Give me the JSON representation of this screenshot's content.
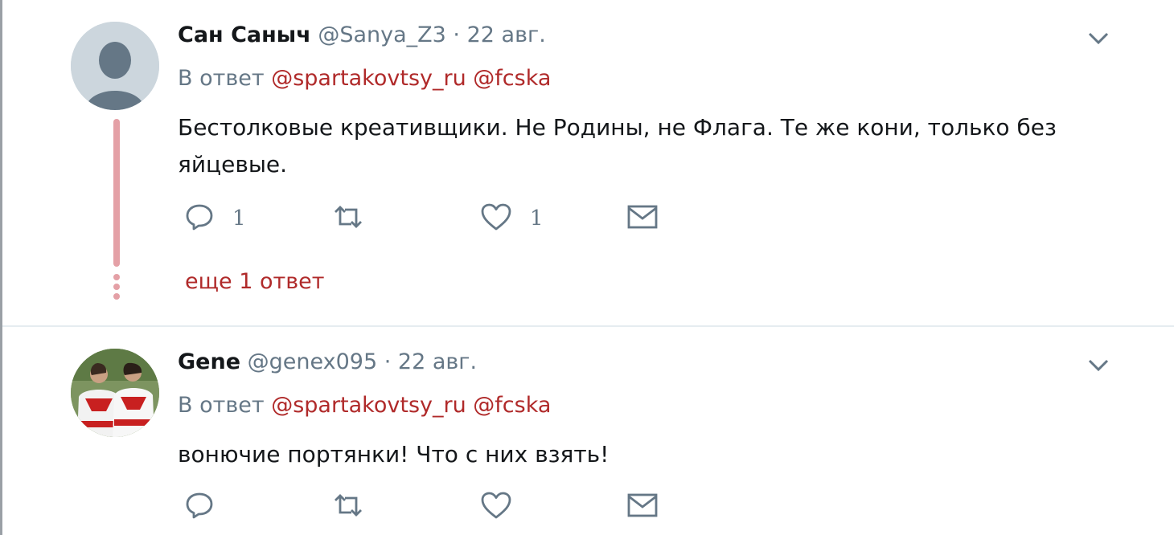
{
  "tweets": [
    {
      "name": "Сан Саныч",
      "handle": "@Sanya_Z3",
      "sep": "·",
      "date": "22 авг.",
      "reply_prefix": "В ответ",
      "mentions": [
        "@spartakovtsy_ru",
        "@fcska"
      ],
      "text": "Бестолковые креативщики. Не Родины, не Флага. Те же кони, только без яйцевые.",
      "reply_count": "1",
      "retweet_count": "",
      "like_count": "1",
      "more_replies": "еще 1 ответ",
      "avatar": "default-avatar"
    },
    {
      "name": "Gene",
      "handle": "@genex095",
      "sep": "·",
      "date": "22 авг.",
      "reply_prefix": "В ответ",
      "mentions": [
        "@spartakovtsy_ru",
        "@fcska"
      ],
      "text": "вонючие портянки! Что с них взять!",
      "reply_count": "",
      "retweet_count": "",
      "like_count": "",
      "avatar": "photo-avatar"
    }
  ],
  "icons": {
    "reply": "reply-icon",
    "retweet": "retweet-icon",
    "like": "heart-icon",
    "dm": "envelope-icon",
    "menu": "chevron-down-icon"
  },
  "colors": {
    "mention": "#b02a2a",
    "secondary_text": "#657786",
    "thread_line": "#e4a0a6"
  }
}
